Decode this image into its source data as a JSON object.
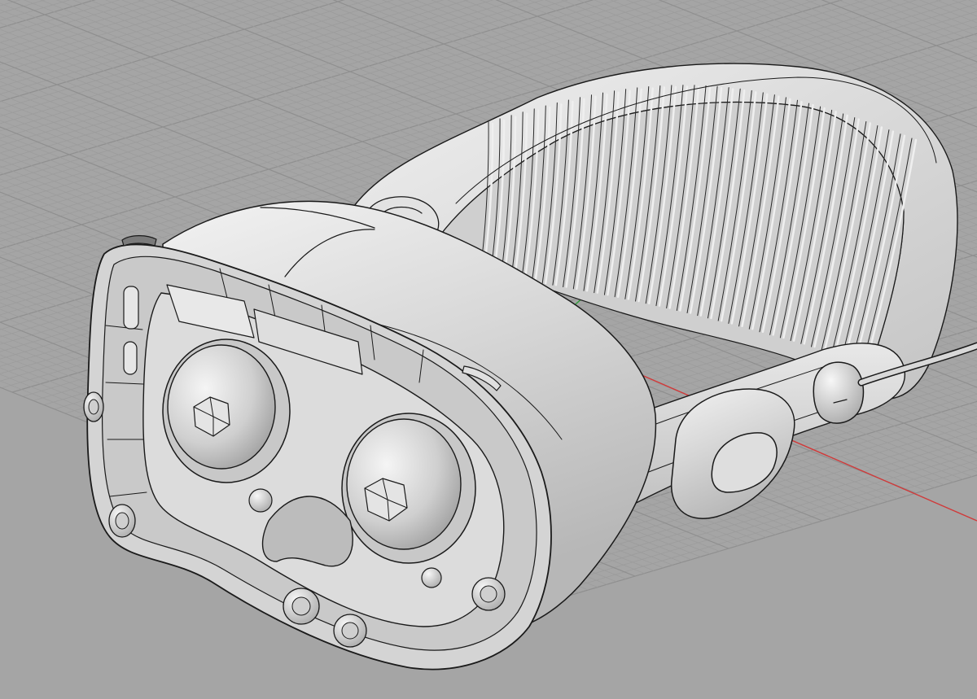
{
  "viewport": {
    "view": "perspective",
    "background_color": "#a5a5a5",
    "grid": {
      "visible": true,
      "minor_color": "#9c9c9c",
      "major_color": "#8f8f8f"
    },
    "axes": {
      "x_axis_color": "#d03a3a",
      "y_axis_color": "#2f9e3a"
    },
    "display_mode": "shaded",
    "model": {
      "surface_color": "#d9d9d9",
      "edge_color": "#1a1a1a",
      "parts": [
        "headband",
        "headband-ribs",
        "visor-shell",
        "light-seal-frame",
        "left-lens",
        "right-lens",
        "nose-bridge",
        "sensor-cameras",
        "side-strap",
        "strap-adjust-pad",
        "power-connector",
        "cable"
      ]
    }
  }
}
